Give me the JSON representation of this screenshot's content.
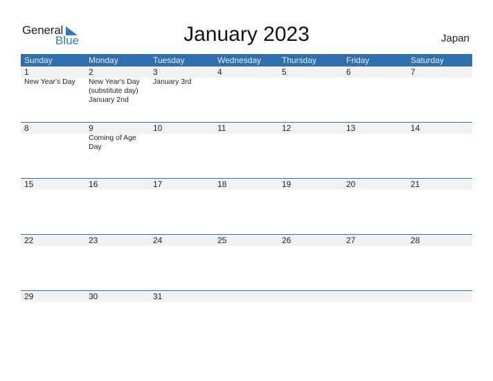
{
  "logo": {
    "line1": "General",
    "line2": "Blue"
  },
  "title": "January 2023",
  "country": "Japan",
  "colors": {
    "header": "#2e6fad",
    "band": "#f2f2f2",
    "brand": "#2a7cc7"
  },
  "weekdays": [
    "Sunday",
    "Monday",
    "Tuesday",
    "Wednesday",
    "Thursday",
    "Friday",
    "Saturday"
  ],
  "weeks": [
    [
      {
        "n": "1",
        "ev": "New Year's Day"
      },
      {
        "n": "2",
        "ev": "New Year's Day\n(substitute day)\n  January 2nd"
      },
      {
        "n": "3",
        "ev": "January 3rd"
      },
      {
        "n": "4",
        "ev": ""
      },
      {
        "n": "5",
        "ev": ""
      },
      {
        "n": "6",
        "ev": ""
      },
      {
        "n": "7",
        "ev": ""
      }
    ],
    [
      {
        "n": "8",
        "ev": ""
      },
      {
        "n": "9",
        "ev": "Coming of Age Day"
      },
      {
        "n": "10",
        "ev": ""
      },
      {
        "n": "11",
        "ev": ""
      },
      {
        "n": "12",
        "ev": ""
      },
      {
        "n": "13",
        "ev": ""
      },
      {
        "n": "14",
        "ev": ""
      }
    ],
    [
      {
        "n": "15",
        "ev": ""
      },
      {
        "n": "16",
        "ev": ""
      },
      {
        "n": "17",
        "ev": ""
      },
      {
        "n": "18",
        "ev": ""
      },
      {
        "n": "19",
        "ev": ""
      },
      {
        "n": "20",
        "ev": ""
      },
      {
        "n": "21",
        "ev": ""
      }
    ],
    [
      {
        "n": "22",
        "ev": ""
      },
      {
        "n": "23",
        "ev": ""
      },
      {
        "n": "24",
        "ev": ""
      },
      {
        "n": "25",
        "ev": ""
      },
      {
        "n": "26",
        "ev": ""
      },
      {
        "n": "27",
        "ev": ""
      },
      {
        "n": "28",
        "ev": ""
      }
    ],
    [
      {
        "n": "29",
        "ev": ""
      },
      {
        "n": "30",
        "ev": ""
      },
      {
        "n": "31",
        "ev": ""
      },
      {
        "n": "",
        "ev": ""
      },
      {
        "n": "",
        "ev": ""
      },
      {
        "n": "",
        "ev": ""
      },
      {
        "n": "",
        "ev": ""
      }
    ]
  ]
}
